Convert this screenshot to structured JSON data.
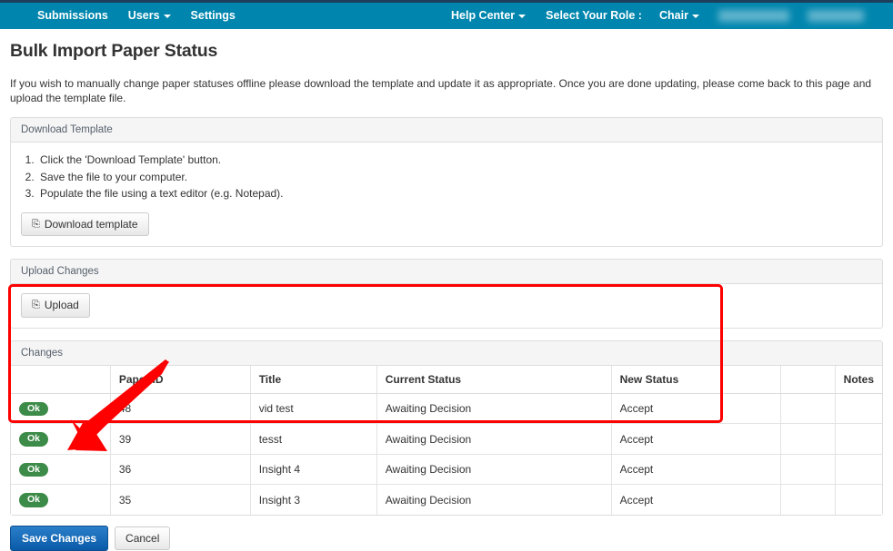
{
  "navbar": {
    "background_color": "#0086ae",
    "top_strip_color": "#1d3f5c",
    "left_items": [
      {
        "label": "Submissions",
        "has_caret": false
      },
      {
        "label": "Users",
        "has_caret": true
      },
      {
        "label": "Settings",
        "has_caret": false
      }
    ],
    "help_center_label": "Help Center",
    "select_role_label": "Select Your Role :",
    "role_value": "Chair",
    "redacted_user": "",
    "redacted_extra": ""
  },
  "page": {
    "title": "Bulk Import Paper Status",
    "intro": "If you wish to manually change paper statuses offline please download the template and update it as appropriate. Once you are done updating, please come back to this page and upload the template file."
  },
  "download_panel": {
    "heading": "Download Template",
    "steps": [
      "Click the 'Download Template' button.",
      "Save the file to your computer.",
      "Populate the file using a text editor (e.g. Notepad)."
    ],
    "button_label": "Download template",
    "button_icon": "download-circle-icon"
  },
  "upload_panel": {
    "heading": "Upload Changes",
    "button_label": "Upload",
    "button_icon": "upload-circle-icon"
  },
  "changes_panel": {
    "heading": "Changes",
    "columns": [
      "",
      "Paper ID",
      "Title",
      "Current Status",
      "New Status",
      "",
      "Notes"
    ],
    "rows": [
      {
        "status": "Ok",
        "paper_id": "48",
        "title": "vid test",
        "current_status": "Awaiting Decision",
        "new_status": "Accept",
        "extra": "",
        "notes": ""
      },
      {
        "status": "Ok",
        "paper_id": "39",
        "title": "tesst",
        "current_status": "Awaiting Decision",
        "new_status": "Accept",
        "extra": "",
        "notes": ""
      },
      {
        "status": "Ok",
        "paper_id": "36",
        "title": "Insight 4",
        "current_status": "Awaiting Decision",
        "new_status": "Accept",
        "extra": "",
        "notes": ""
      },
      {
        "status": "Ok",
        "paper_id": "35",
        "title": "Insight 3",
        "current_status": "Awaiting Decision",
        "new_status": "Accept",
        "extra": "",
        "notes": ""
      }
    ],
    "badge_color": "#3d8b48"
  },
  "footer": {
    "save_label": "Save Changes",
    "cancel_label": "Cancel",
    "save_color": "#0a5aa8"
  },
  "annotations": {
    "highlight_color": "#fe0000",
    "rectangle_target": "changes-table",
    "arrow_target": "save-changes-button"
  }
}
